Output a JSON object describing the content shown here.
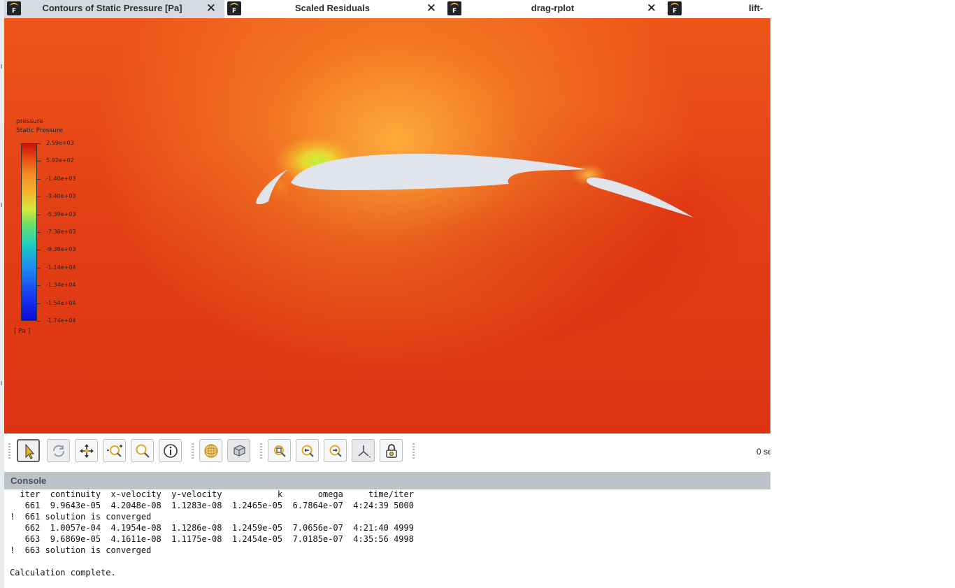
{
  "tabs": [
    {
      "label": "Contours of Static Pressure [Pa]",
      "active": true
    },
    {
      "label": "Scaled Residuals",
      "active": false
    },
    {
      "label": "drag-rplot",
      "active": false
    },
    {
      "label": "lift-",
      "active": false
    }
  ],
  "viewport": {
    "legend": {
      "title1": "pressure",
      "title2": "Static Pressure",
      "unit": "[ Pa ]",
      "levels": [
        "2.59e+03",
        "5.92e+02",
        "-1.40e+03",
        "-3.40e+03",
        "-5.39e+03",
        "-7.38e+03",
        "-9.38e+03",
        "-1.14e+04",
        "-1.34e+04",
        "-1.54e+04",
        "-1.74e+04"
      ]
    }
  },
  "toolbar": {
    "buttons": [
      {
        "name": "select-pointer-button",
        "icon": "pointer-icon",
        "selected": true
      },
      {
        "name": "rotate-view-button",
        "icon": "rotate-icon",
        "selected": false
      },
      {
        "name": "pan-button",
        "icon": "pan-arrows-icon",
        "selected": false
      },
      {
        "name": "zoom-in-out-button",
        "icon": "zoom-in-out-icon",
        "selected": false
      },
      {
        "name": "zoom-to-area-button",
        "icon": "magnifier-icon",
        "selected": false
      },
      {
        "name": "probe-button",
        "icon": "info-icon",
        "selected": false
      },
      {
        "name": "mesh-display-button",
        "icon": "mesh-sphere-icon",
        "selected": false
      },
      {
        "name": "view-box-button",
        "icon": "cube-view-icon",
        "selected": false
      },
      {
        "name": "fit-to-window-button",
        "icon": "zoom-fit-icon",
        "selected": false
      },
      {
        "name": "zoom-out-button",
        "icon": "zoom-out-icon",
        "selected": false
      },
      {
        "name": "zoom-in-button",
        "icon": "zoom-in-icon",
        "selected": false
      },
      {
        "name": "axes-button",
        "icon": "axes-icon",
        "selected": false
      },
      {
        "name": "lock-view-button",
        "icon": "lock-icon",
        "selected": false
      }
    ],
    "timer_text": "0 se"
  },
  "console": {
    "title": "Console",
    "lines": [
      "  iter  continuity  x-velocity  y-velocity           k       omega     time/iter",
      "   661  9.9643e-05  4.2048e-08  1.1283e-08  1.2465e-05  6.7864e-07  4:24:39 5000",
      "!  661 solution is converged",
      "   662  1.0057e-04  4.1954e-08  1.1286e-08  1.2459e-05  7.0656e-07  4:21:40 4999",
      "   663  9.6869e-05  4.1611e-08  1.1175e-08  1.2454e-05  7.0185e-07  4:35:56 4998",
      "!  663 solution is converged",
      "",
      "Calculation complete."
    ]
  },
  "colors": {
    "pressure_high": "#c8120a",
    "pressure_low": "#0a0ad8",
    "airfoil_fill": "#e2e4ec",
    "tab_active_bg": "#d6dae0",
    "console_header_bg": "#bcc2ca"
  }
}
